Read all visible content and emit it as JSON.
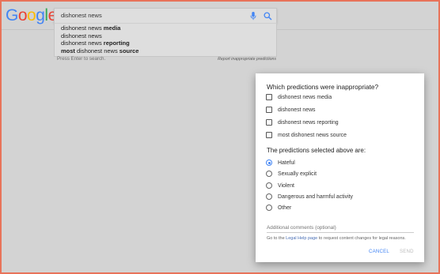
{
  "header": {
    "logo_letters": [
      {
        "ch": "G",
        "color": "#4285f4"
      },
      {
        "ch": "o",
        "color": "#ea4335"
      },
      {
        "ch": "o",
        "color": "#fbbc05"
      },
      {
        "ch": "g",
        "color": "#4285f4"
      },
      {
        "ch": "l",
        "color": "#34a853"
      },
      {
        "ch": "e",
        "color": "#ea4335"
      }
    ],
    "search_value": "dishonest news",
    "mic_icon": "mic-icon",
    "search_icon": "search-icon"
  },
  "suggestions": [
    {
      "prefix": "dishonest news ",
      "bold": "media",
      "suffix": ""
    },
    {
      "prefix": "dishonest news",
      "bold": "",
      "suffix": ""
    },
    {
      "prefix": "dishonest news ",
      "bold": "reporting",
      "suffix": ""
    },
    {
      "prefixBold": "most",
      "prefix": " dishonest news ",
      "bold": "source",
      "suffix": ""
    }
  ],
  "hint": "Press Enter to search.",
  "report_link": "Report inappropriate predictions",
  "dialog": {
    "title": "Which predictions were inappropriate?",
    "predictions": [
      {
        "label": "dishonest news media",
        "checked": false
      },
      {
        "label": "dishonest news",
        "checked": false
      },
      {
        "label": "dishonest news reporting",
        "checked": false
      },
      {
        "label": "most dishonest news source",
        "checked": false
      }
    ],
    "reasons_title": "The predictions selected above are:",
    "reasons": [
      {
        "label": "Hateful",
        "selected": true
      },
      {
        "label": "Sexually explicit",
        "selected": false
      },
      {
        "label": "Violent",
        "selected": false
      },
      {
        "label": "Dangerous and harmful activity",
        "selected": false
      },
      {
        "label": "Other",
        "selected": false
      }
    ],
    "comments_placeholder": "Additional comments (optional)",
    "legal_prefix": "Go to the ",
    "legal_link": "Legal Help page",
    "legal_suffix": " to request content changes for legal reasons.",
    "cancel_label": "CANCEL",
    "send_label": "SEND",
    "accent_color": "#4285f4"
  }
}
